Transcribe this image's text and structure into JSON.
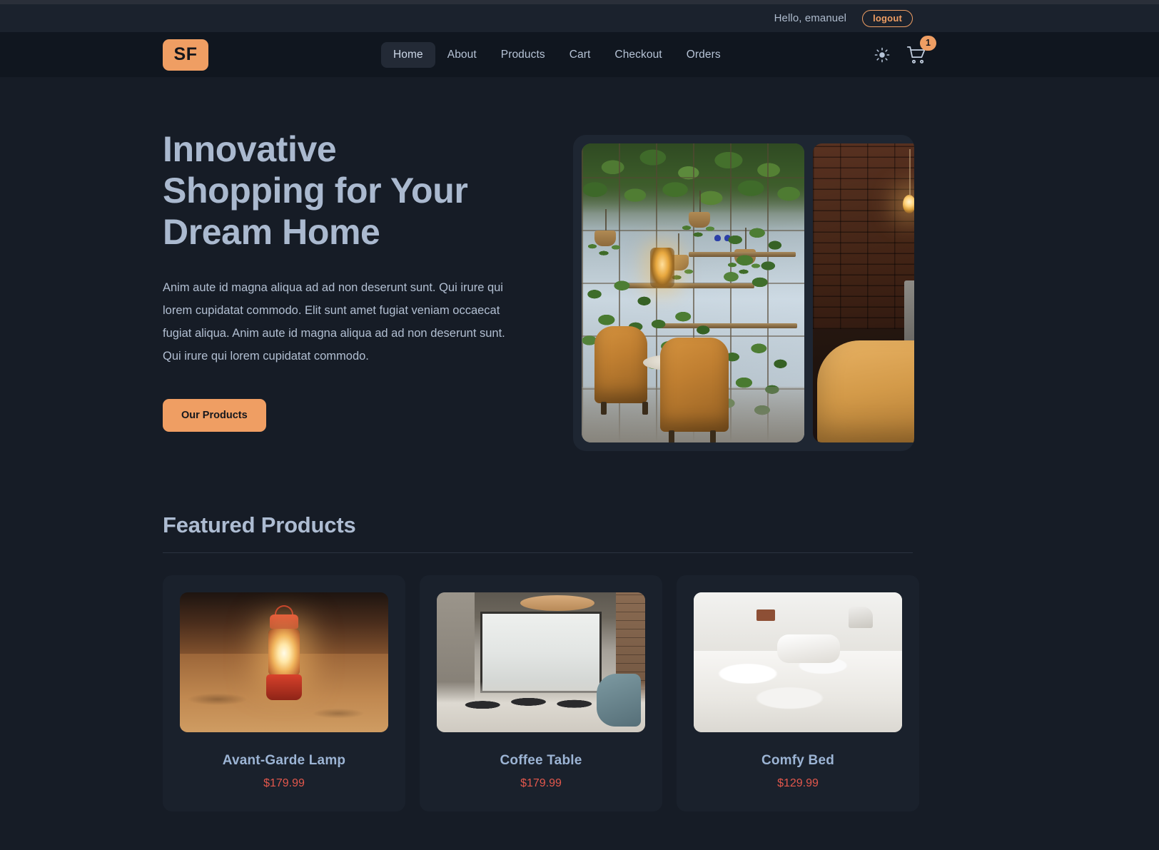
{
  "topbar": {
    "greeting": "Hello, emanuel",
    "logout_label": "logout"
  },
  "nav": {
    "logo_text": "SF",
    "links": [
      {
        "label": "Home",
        "active": true
      },
      {
        "label": "About",
        "active": false
      },
      {
        "label": "Products",
        "active": false
      },
      {
        "label": "Cart",
        "active": false
      },
      {
        "label": "Checkout",
        "active": false
      },
      {
        "label": "Orders",
        "active": false
      }
    ],
    "theme_toggle_icon": "sun-icon",
    "cart_icon": "shopping-cart-icon",
    "cart_count": "1"
  },
  "hero": {
    "title_line_1": "Innovative",
    "title_line_2": "Shopping for Your",
    "title_line_3": "Dream Home",
    "paragraph": "Anim aute id magna aliqua ad ad non deserunt sunt. Qui irure qui lorem cupidatat commodo. Elit sunt amet fugiat veniam occaecat fugiat aliqua. Anim aute id magna aliqua ad ad non deserunt sunt. Qui irure qui lorem cupidatat commodo.",
    "cta_label": "Our Products"
  },
  "featured": {
    "heading": "Featured Products",
    "products": [
      {
        "name": "Avant-Garde Lamp",
        "price": "$179.99"
      },
      {
        "name": "Coffee Table",
        "price": "$179.99"
      },
      {
        "name": "Comfy Bed",
        "price": "$129.99"
      }
    ]
  },
  "colors": {
    "accent_orange": "#ef9e63",
    "page_background": "#161c26",
    "nav_background": "#10161f",
    "topbar_background": "#1b222d",
    "card_background": "#1a212c",
    "heading_text": "#aab9cf",
    "price_red": "#e2574c"
  }
}
